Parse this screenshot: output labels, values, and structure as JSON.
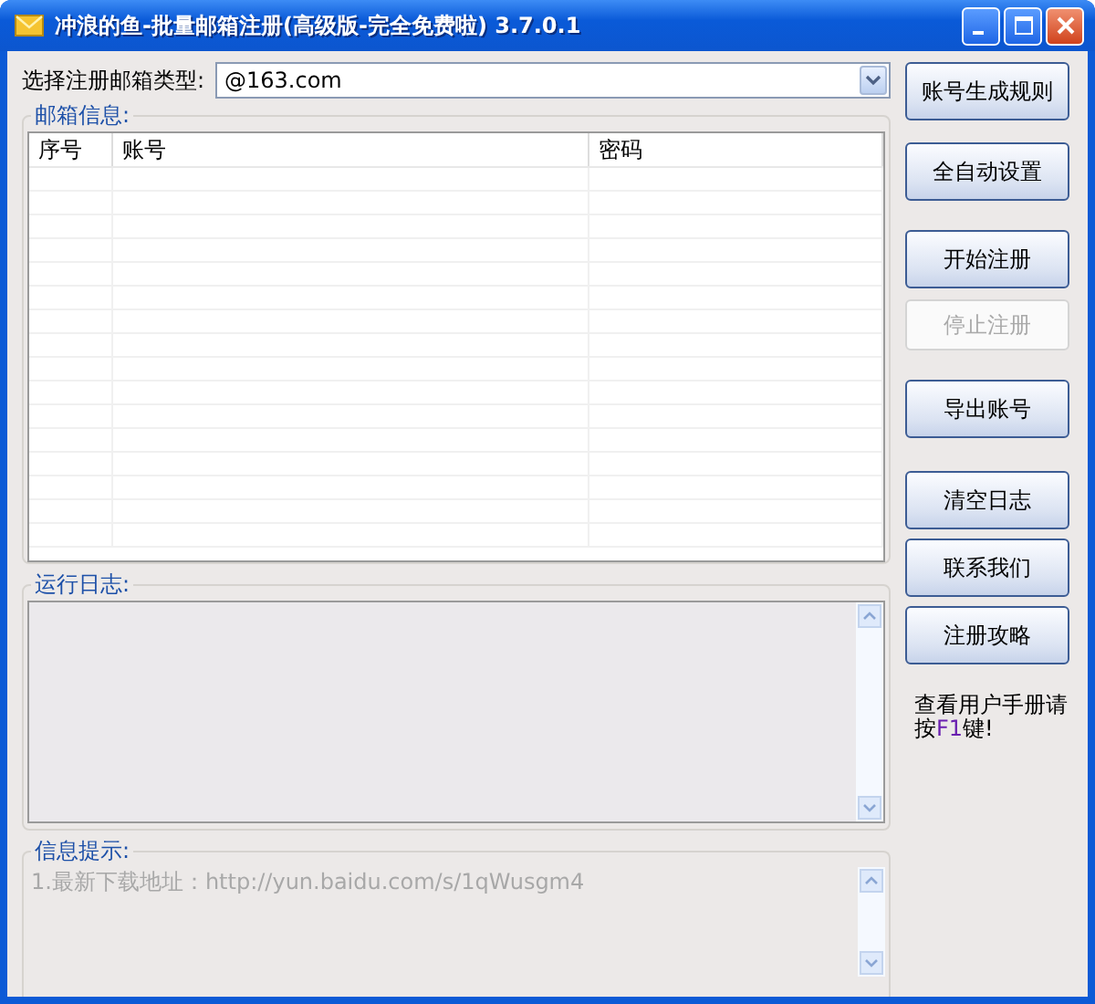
{
  "window": {
    "title": "冲浪的鱼-批量邮箱注册(高级版-完全免费啦) 3.7.0.1"
  },
  "mail_type": {
    "label": "选择注册邮箱类型:",
    "value": "@163.com"
  },
  "mailbox_group": {
    "title": "邮箱信息:",
    "table": {
      "columns": [
        "序号",
        "账号",
        "密码"
      ]
    }
  },
  "log_group": {
    "title": "运行日志:"
  },
  "info_group": {
    "title": "信息提示:",
    "lines": [
      "1.最新下载地址：http://yun.baidu.com/s/1qWusgm4"
    ]
  },
  "buttons": [
    {
      "label": "账号生成规则",
      "disabled": false
    },
    {
      "label": "全自动设置",
      "disabled": false
    },
    {
      "label": "开始注册",
      "disabled": false
    },
    {
      "label": "停止注册",
      "disabled": true
    },
    {
      "label": "导出账号",
      "disabled": false
    },
    {
      "label": "清空日志",
      "disabled": false
    },
    {
      "label": "联系我们",
      "disabled": false
    },
    {
      "label": "注册攻略",
      "disabled": false
    }
  ],
  "help_text": [
    {
      "text": "查看用户手册请按",
      "highlight": false
    },
    {
      "text": "F1",
      "highlight": true
    },
    {
      "text": "键!",
      "highlight": false
    }
  ]
}
